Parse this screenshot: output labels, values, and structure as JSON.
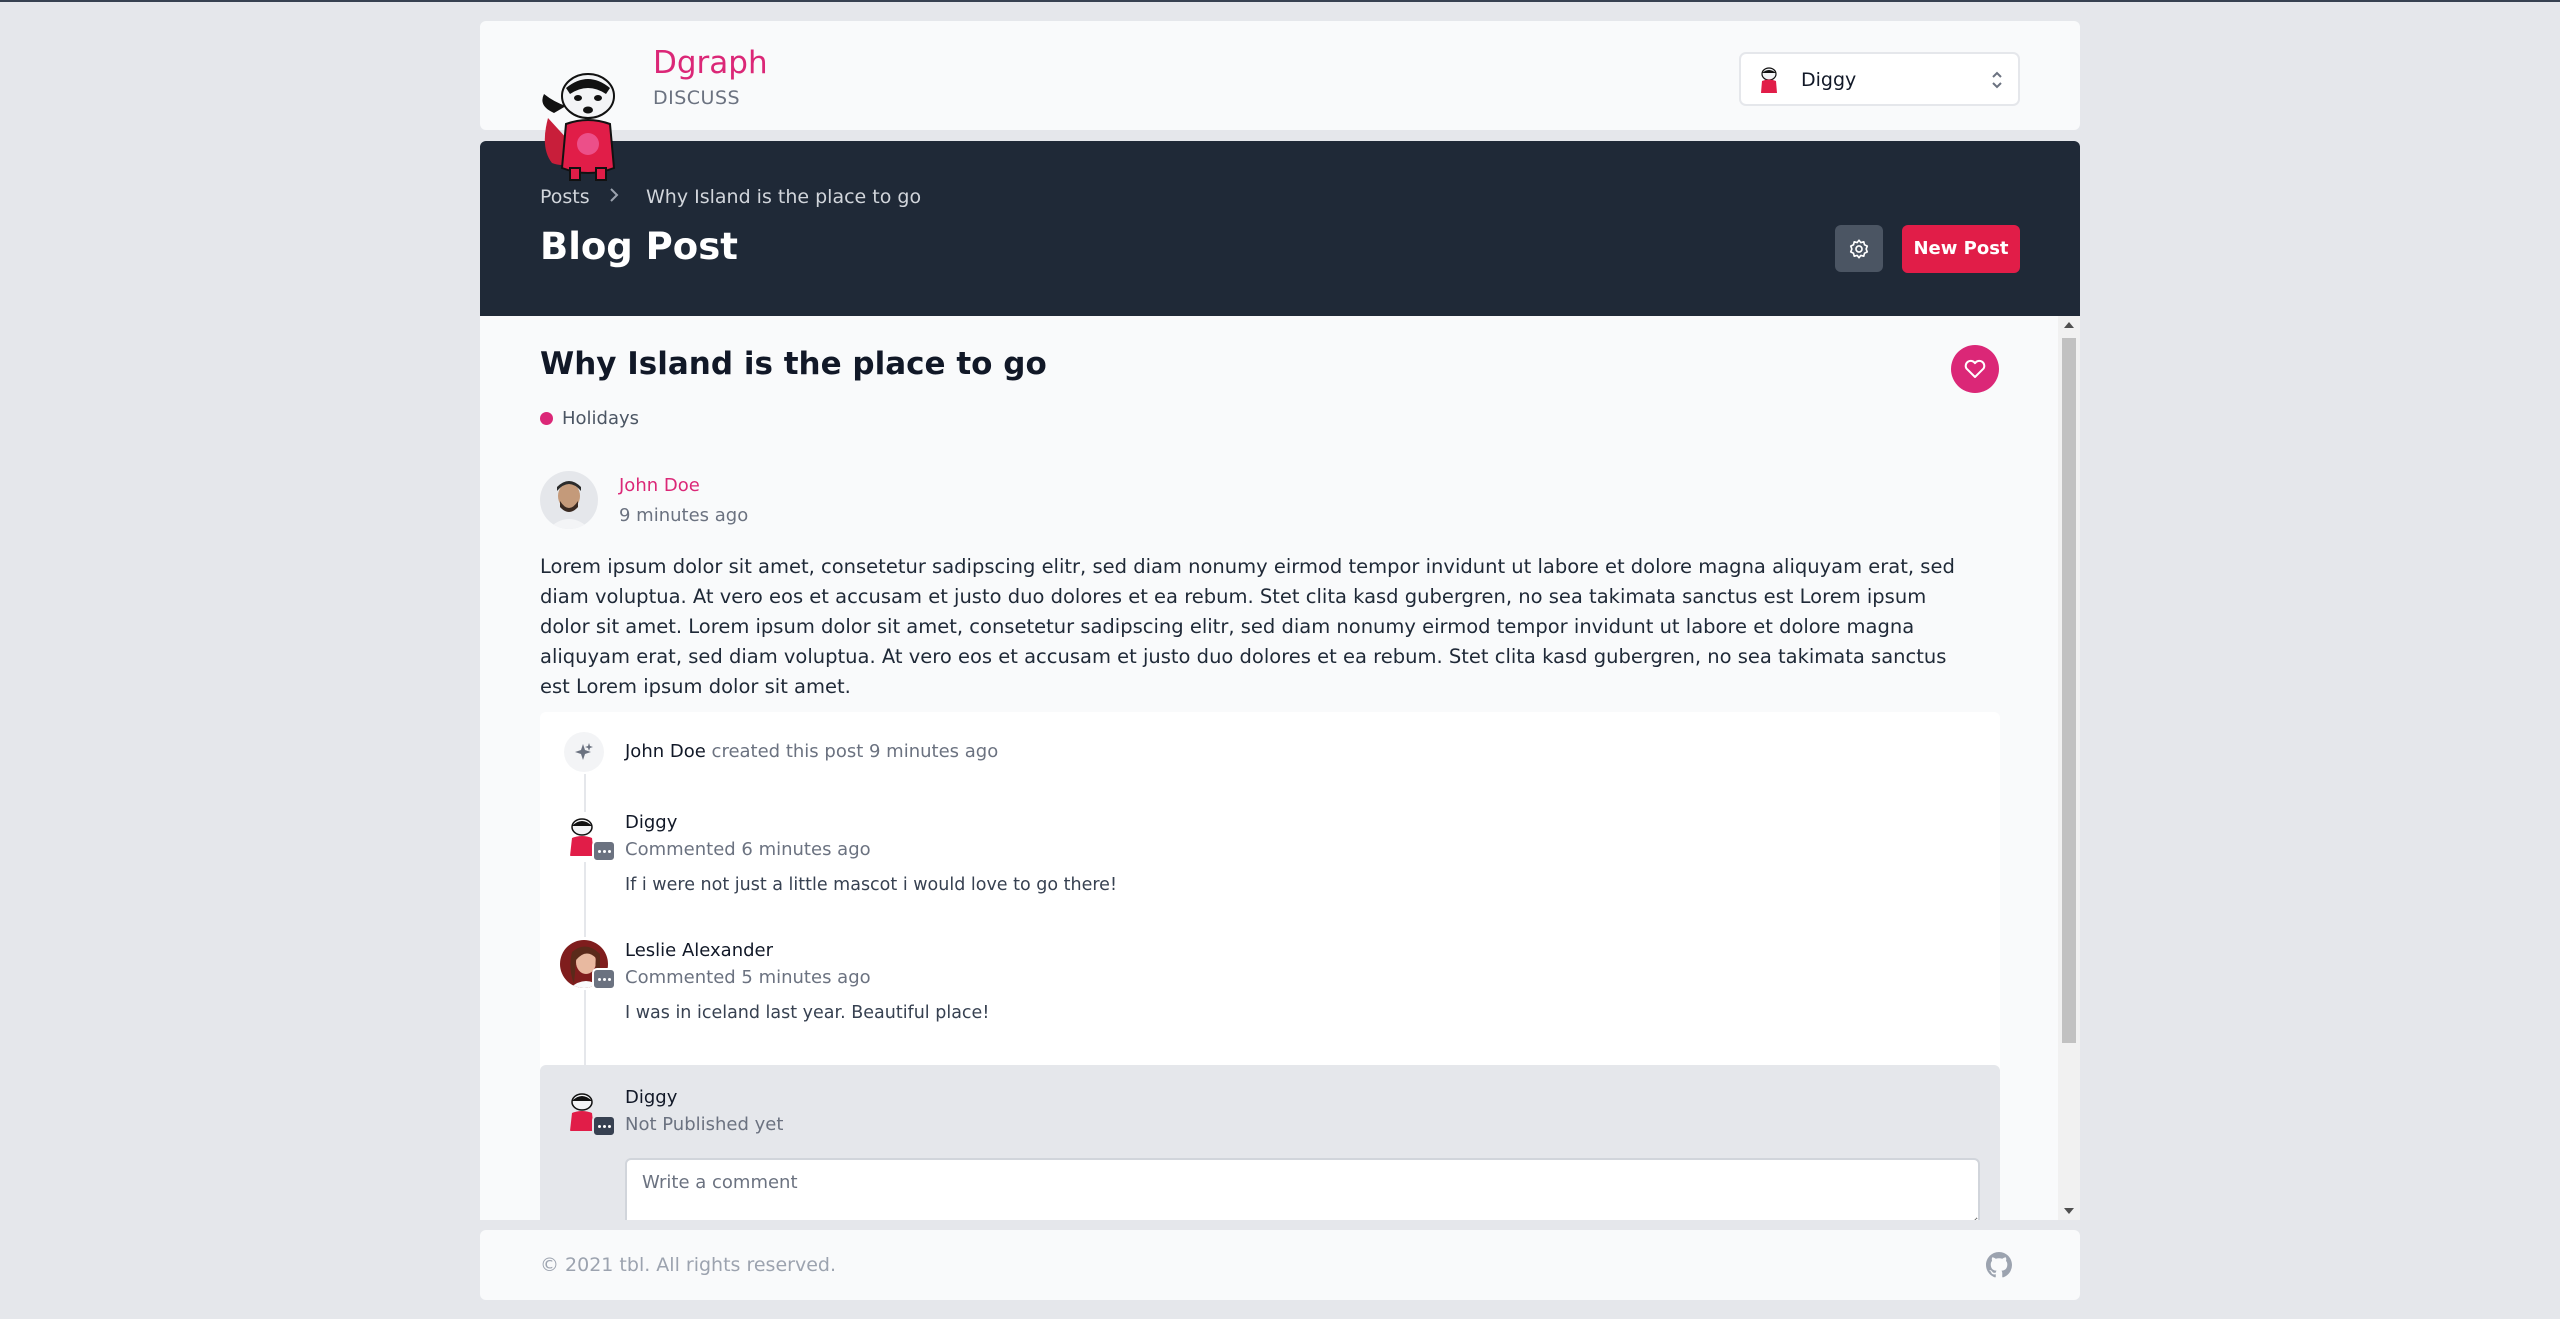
{
  "brand": {
    "name": "Dgraph",
    "subtitle": "DISCUSS"
  },
  "user_menu": {
    "selected_user": "Diggy"
  },
  "breadcrumb": {
    "root": "Posts",
    "current": "Why Island is the place to go"
  },
  "hero": {
    "title": "Blog Post",
    "new_post_label": "New Post"
  },
  "post": {
    "title": "Why Island is the place to go",
    "tag": "Holidays",
    "tag_color": "#db2777",
    "author": "John Doe",
    "time": "9 minutes ago",
    "body": "Lorem ipsum dolor sit amet, consetetur sadipscing elitr, sed diam nonumy eirmod tempor invidunt ut labore et dolore magna aliquyam erat, sed diam voluptua. At vero eos et accusam et justo duo dolores et ea rebum. Stet clita kasd gubergren, no sea takimata sanctus est Lorem ipsum dolor sit amet. Lorem ipsum dolor sit amet, consetetur sadipscing elitr, sed diam nonumy eirmod tempor invidunt ut labore et dolore magna aliquyam erat, sed diam voluptua. At vero eos et accusam et justo duo dolores et ea rebum. Stet clita kasd gubergren, no sea takimata sanctus est Lorem ipsum dolor sit amet."
  },
  "timeline": {
    "created": {
      "author": "John Doe",
      "text": "created this post 9 minutes ago"
    },
    "comments": [
      {
        "author": "Diggy",
        "time": "Commented 6 minutes ago",
        "text": "If i were not just a little mascot i would love to go there!"
      },
      {
        "author": "Leslie Alexander",
        "time": "Commented 5 minutes ago",
        "text": "I was in iceland last year. Beautiful place!"
      }
    ],
    "compose": {
      "author": "Diggy",
      "status": "Not Published yet",
      "placeholder": "Write a comment"
    }
  },
  "footer": {
    "copyright": "© 2021 tbl. All rights reserved."
  },
  "colors": {
    "accent": "#db2777",
    "button": "#e11d48",
    "hero_bg": "#1f2937"
  },
  "icons": [
    "chevron-up-down-icon",
    "chevron-right-icon",
    "gear-icon",
    "heart-icon",
    "sparkles-icon",
    "chat-bubble-icon",
    "github-icon"
  ]
}
